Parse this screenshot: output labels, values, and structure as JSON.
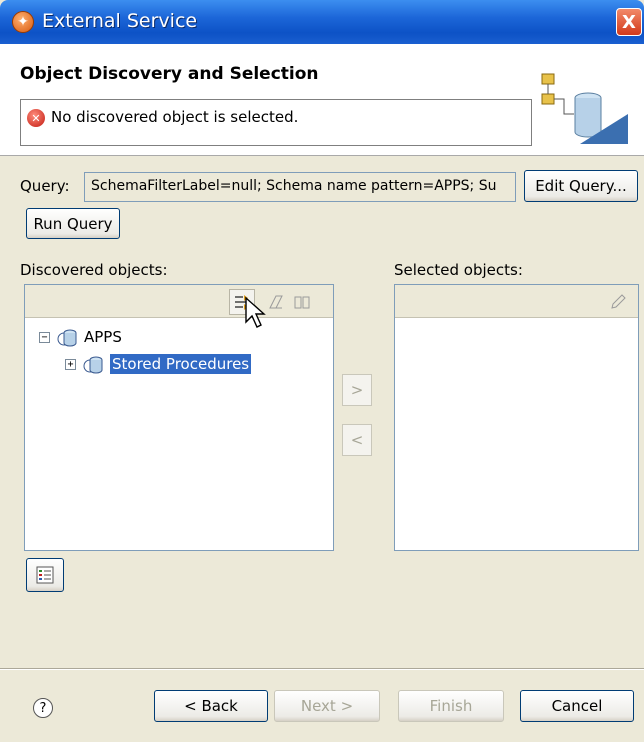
{
  "window": {
    "title": "External Service",
    "close_label": "X"
  },
  "header": {
    "title": "Object Discovery and Selection",
    "message": "No discovered object is selected.",
    "message_icon": "error-icon"
  },
  "query": {
    "label": "Query:",
    "value": "SchemaFilterLabel=null; Schema name pattern=APPS; Su",
    "edit_button": "Edit Query...",
    "run_button": "Run Query"
  },
  "discovered": {
    "label": "Discovered objects:",
    "toolbar": [
      "filter-icon",
      "eraser-icon",
      "book-icon"
    ],
    "tree": [
      {
        "label": "APPS",
        "expander": "−",
        "level": 0
      },
      {
        "label": "Stored Procedures",
        "expander": "+",
        "level": 1,
        "selected": true
      }
    ]
  },
  "transfer": {
    "add_label": ">",
    "remove_label": "<"
  },
  "selected": {
    "label": "Selected objects:",
    "toolbar": [
      "edit-pencil-icon"
    ]
  },
  "footer": {
    "help": "?",
    "back": "< Back",
    "next": "Next >",
    "finish": "Finish",
    "cancel": "Cancel"
  },
  "colors": {
    "title_bar": "#0d52c6",
    "selection": "#316ac5",
    "dialog_bg": "#ece9d8"
  }
}
